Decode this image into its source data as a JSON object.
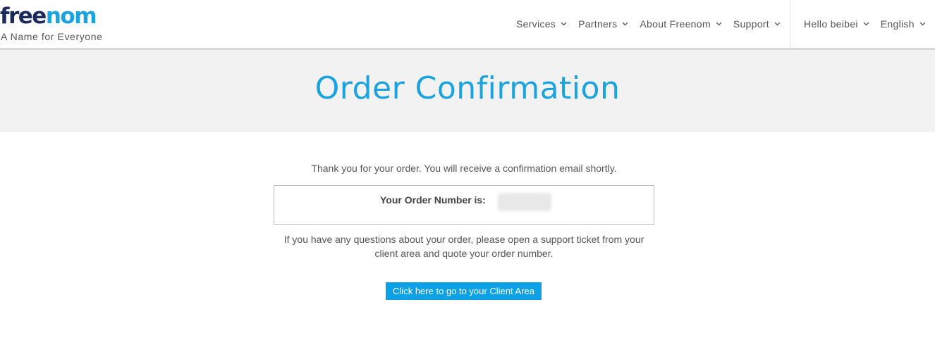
{
  "brand": {
    "logo_free": "free",
    "logo_nom": "nom",
    "tagline": "A Name for Everyone"
  },
  "nav": {
    "main": [
      {
        "label": "Services"
      },
      {
        "label": "Partners"
      },
      {
        "label": "About Freenom"
      },
      {
        "label": "Support"
      }
    ],
    "user_greeting": "Hello beibei",
    "language": "English"
  },
  "page": {
    "title": "Order Confirmation",
    "thanks_text": "Thank you for your order. You will receive a confirmation email shortly.",
    "order_number_label": "Your Order Number is:",
    "support_text": "If you have any questions about your order, please open a support ticket from your client area and quote your order number.",
    "cta_label": "Click here to go to your Client Area"
  },
  "colors": {
    "accent": "#1ba3e0",
    "brand_dark": "#1b2a5a",
    "button": "#0aa1e6"
  }
}
